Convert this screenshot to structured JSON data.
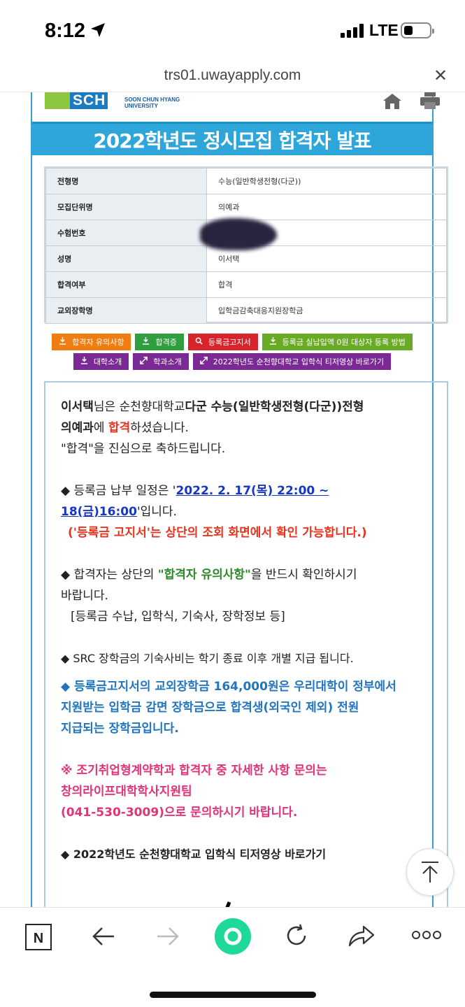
{
  "status_bar": {
    "time": "8:12",
    "network": "LTE"
  },
  "browser": {
    "url": "trs01.uwayapply.com"
  },
  "header": {
    "logo_sch": "SCH",
    "logo_line1": "SOON CHUN HYANG",
    "logo_line2": "UNIVERSITY",
    "banner_title": "2022학년도 정시모집 합격자 발표"
  },
  "info_table": [
    {
      "label": "전형명",
      "value": "수능(일반학생전형(다군))"
    },
    {
      "label": "모집단위명",
      "value": "의예과"
    },
    {
      "label": "수험번호",
      "value": ""
    },
    {
      "label": "성명",
      "value": "이서택"
    },
    {
      "label": "합격여부",
      "value": "합격"
    },
    {
      "label": "교외장학명",
      "value": "입학금감축대응지원장학금"
    }
  ],
  "buttons_row1": [
    {
      "label": "합격자 유의사항",
      "color": "#f07d12",
      "icon": "download-icon"
    },
    {
      "label": "합격증",
      "color": "#2f9e3f",
      "icon": "download-icon"
    },
    {
      "label": "등록금고지서",
      "color": "#d8232a",
      "icon": "search-icon"
    },
    {
      "label": "등록금 실납입액 0원 대상자 등록 방법",
      "color": "#6aab25",
      "icon": "download-icon"
    }
  ],
  "buttons_row2": [
    {
      "label": "대학소개",
      "color": "#7b2a95",
      "icon": "download-icon"
    },
    {
      "label": "학과소개",
      "color": "#7b2a95",
      "icon": "expand-icon"
    },
    {
      "label": "2022학년도 순천향대학교 입학식 티저영상 바로가기",
      "color": "#7b2a95",
      "icon": "expand-icon"
    }
  ],
  "message": {
    "name": "이서택",
    "l1_a": "님은 순천향대학교",
    "l1_b": "다군 수능(일반학생전형(다군))전형",
    "l2_a": "의예과",
    "l2_b": "에 ",
    "l2_c": "합격",
    "l2_d": "하셨습니다.",
    "l3": "\"합격\"을 진심으로 축하드립니다.",
    "p2_a": "◆ 등록금 납부 일정은 '",
    "p2_date1": "2022. 2. 17(목) 22:00 ~",
    "p2_date2": "18(금)16:00",
    "p2_b": "'입니다.",
    "p2_note": "('등록금 고지서'는  상단의 조회 화면에서 확인 가능합니다.)",
    "p3_a": "◆ 합격자는  상단의 ",
    "p3_b": "\"합격자 유의사항\"",
    "p3_c": "을 반드시 확인하시기",
    "p3_d": "바랍니다.",
    "p3_e": "[등록금 수납, 입학식, 기숙사, 장학정보 등]",
    "p4": "◆ SRC 장학금의 기숙사비는 학기 종료 이후 개별 지급 됩니다.",
    "p5_1": "◆ 등록금고지서의 교외장학금 164,000원은 우리대학이 정부에서",
    "p5_2": "지원받는 입학금 감면 장학금으로 합격생(외국인 제외) 전원",
    "p5_3": "지급되는 장학금입니다.",
    "p6_1": "※ 조기취업형계약학과 합격자 중 자세한 사항 문의는",
    "p6_2": "창의라이프대학학사지원팀",
    "p6_3": "(041-530-3009)으로 문의하시기 바랍니다.",
    "p7": "◆ 2022학년도 순천향대학교 입학식 티저영상 바로가기"
  }
}
